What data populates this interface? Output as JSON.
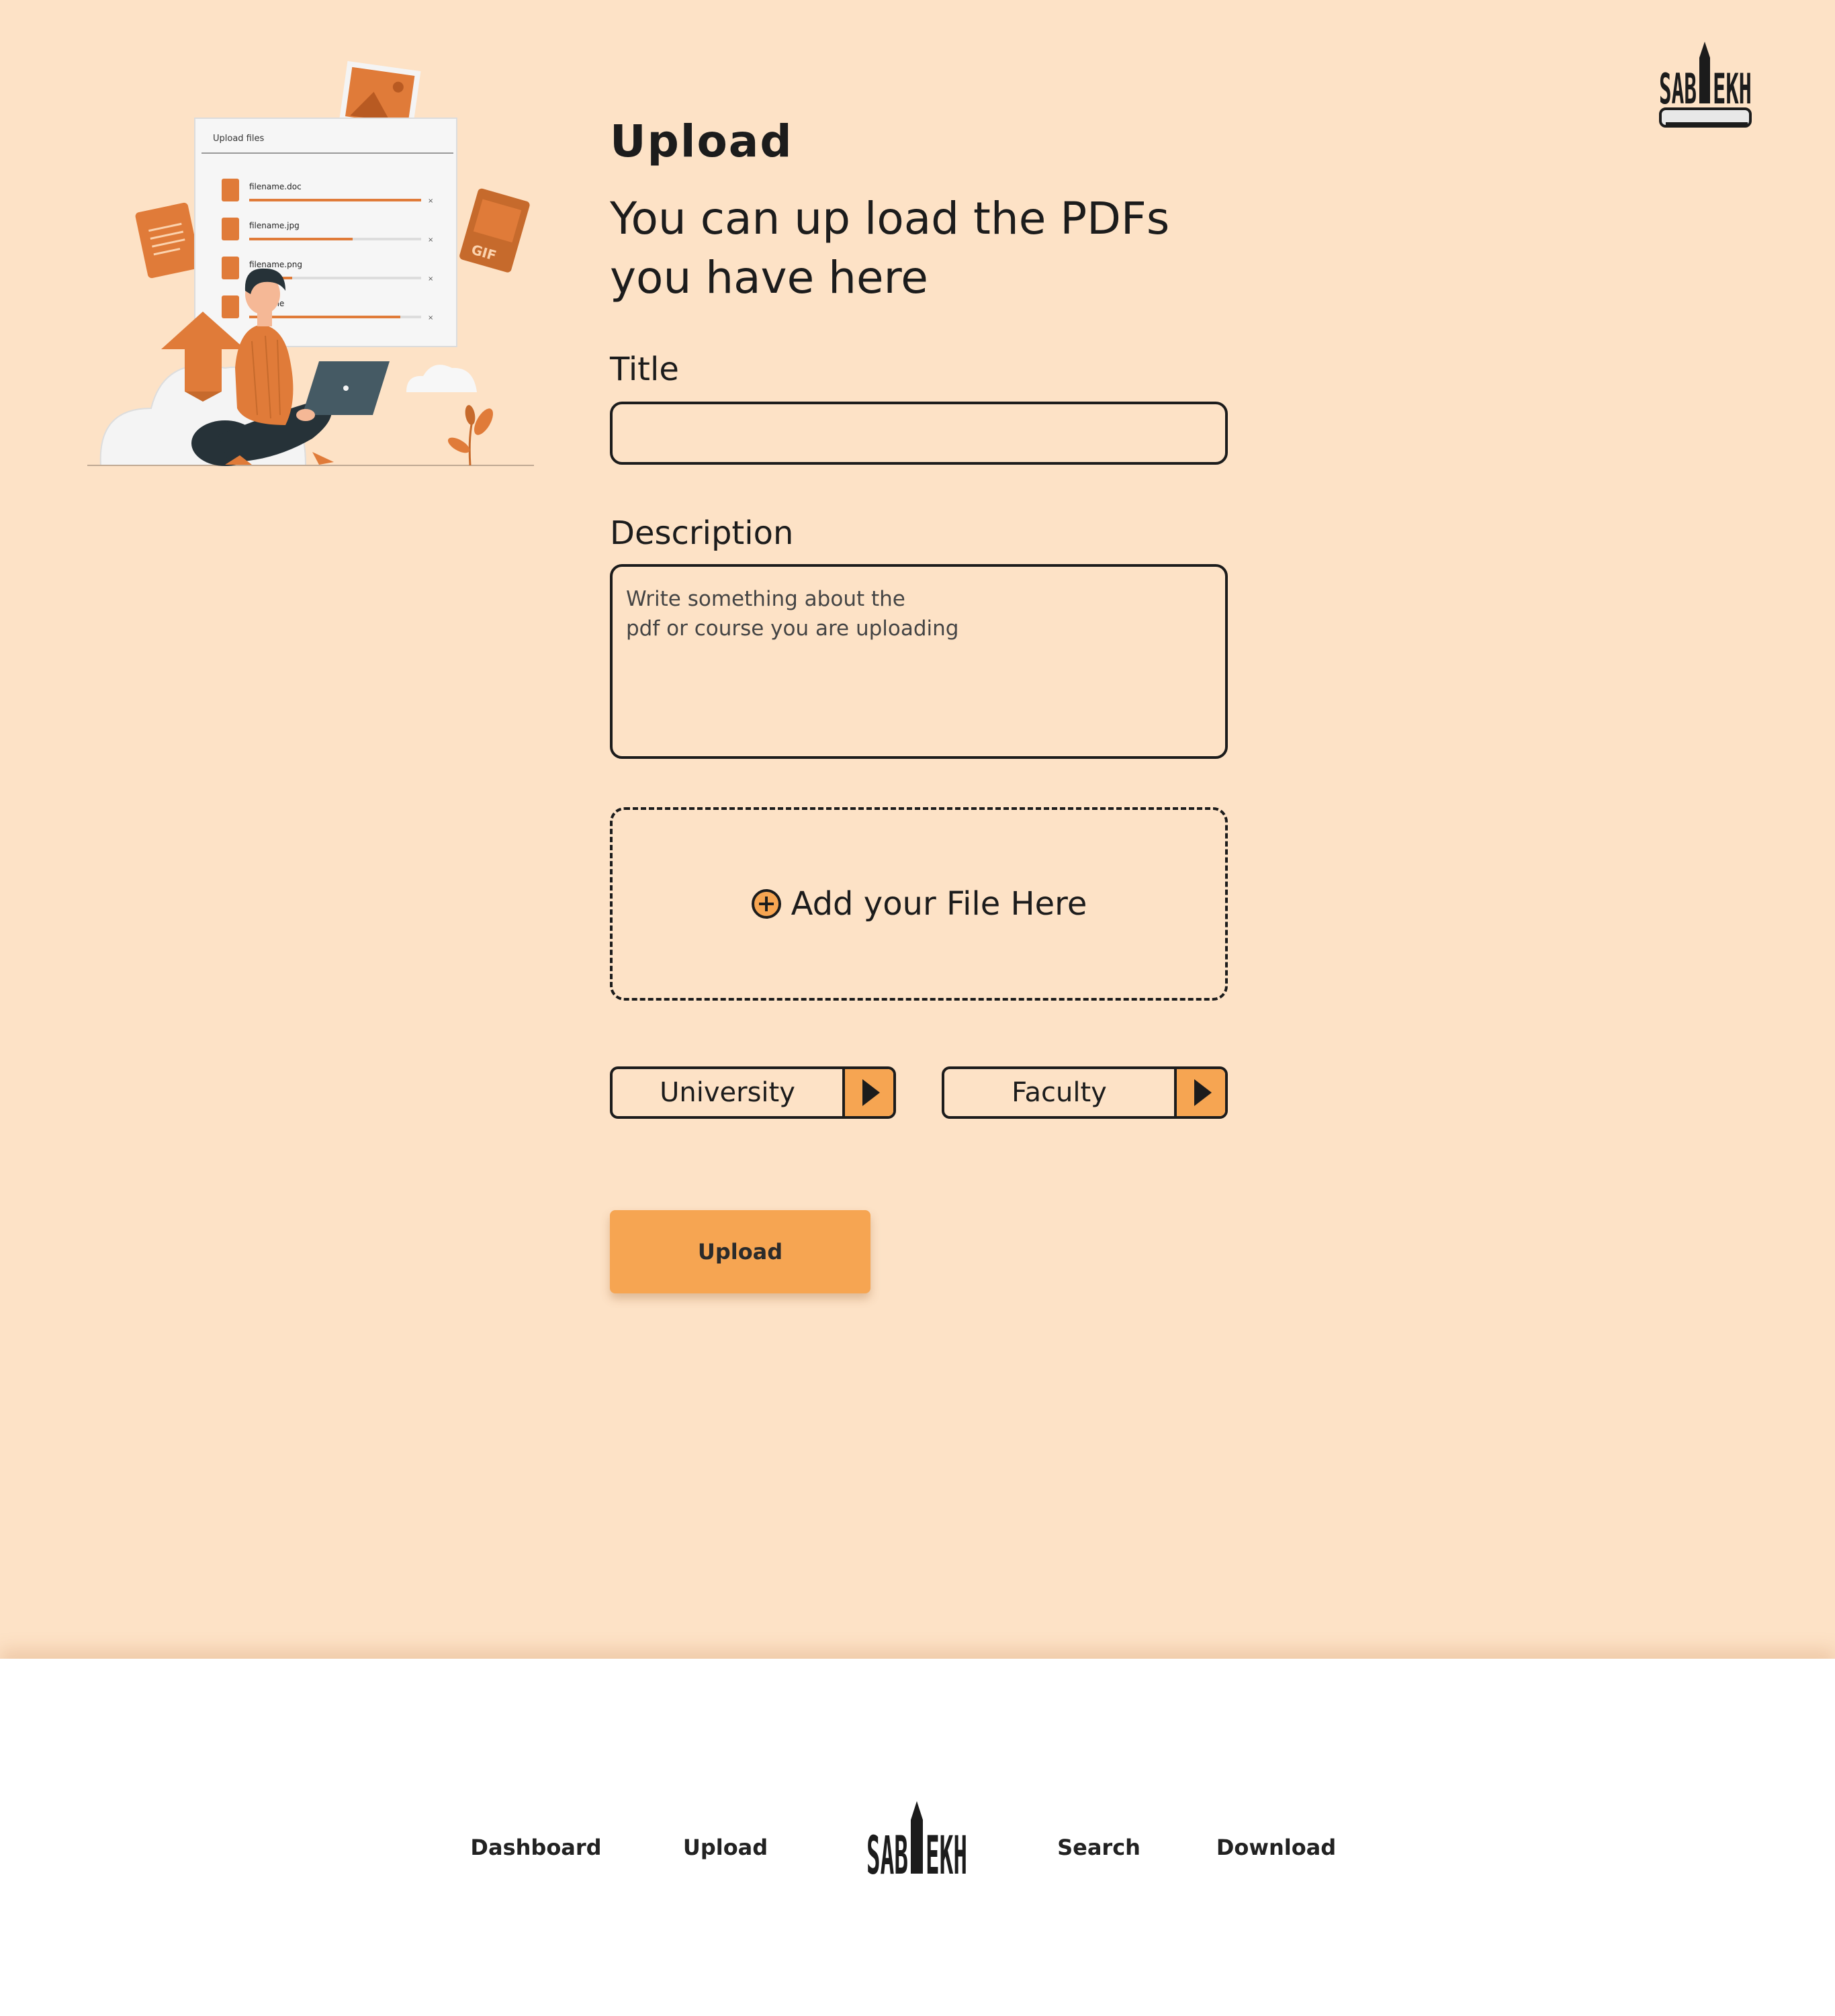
{
  "header": {
    "title": "Upload",
    "subtitle_line1": "You can up load the PDFs",
    "subtitle_line2": "you have here",
    "logo_icon": "sablekh-logo-icon"
  },
  "illustration": {
    "panel_title": "Upload files",
    "files": [
      "filename.doc",
      "filename.jpg",
      "filename.png",
      "filename"
    ],
    "progress": [
      1.0,
      0.6,
      0.25,
      0.88
    ],
    "gif_label": "GIF"
  },
  "form": {
    "title_label": "Title",
    "title_value": "",
    "description_label": "Description",
    "description_placeholder_line1": "Write something about the",
    "description_placeholder_line2": "pdf or course you are uploading",
    "dropzone_label": "Add your File Here",
    "university_select": "University",
    "faculty_select": "Faculty",
    "upload_button": "Upload"
  },
  "footer": {
    "nav": [
      "Dashboard",
      "Upload",
      "Search",
      "Download"
    ],
    "logo_icon": "sablekh-logo-icon"
  },
  "colors": {
    "background": "#fde2c6",
    "accent": "#f6a552",
    "illustration_orange": "#e07b39",
    "text": "#1c1c1c",
    "footer": "#ffffff"
  }
}
